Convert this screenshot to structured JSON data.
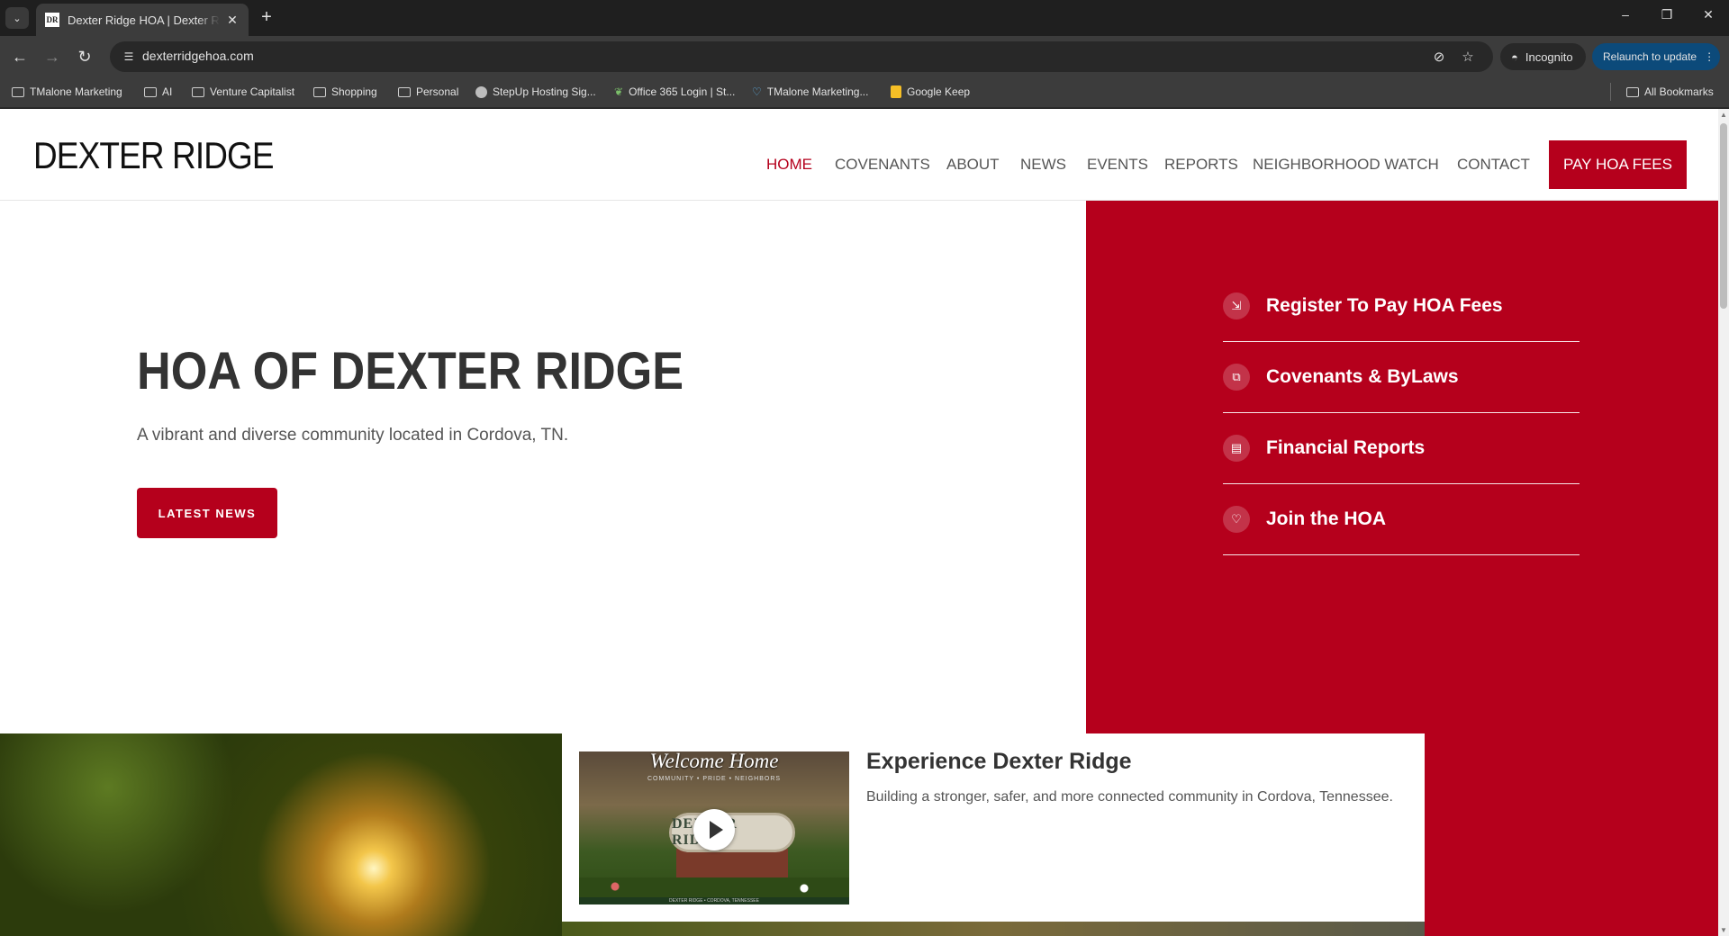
{
  "browser": {
    "tab_title": "Dexter Ridge HOA | Dexter Ridge",
    "tab_favicon": "DR",
    "url": "dexterridgehoa.com",
    "incognito_label": "Incognito",
    "relaunch_label": "Relaunch to update",
    "bookmarks": [
      {
        "label": "TMalone Marketing",
        "icon": "folder-icon"
      },
      {
        "label": "AI",
        "icon": "folder-icon"
      },
      {
        "label": "Venture Capitalist",
        "icon": "folder-icon"
      },
      {
        "label": "Shopping",
        "icon": "folder-icon"
      },
      {
        "label": "Personal",
        "icon": "folder-icon"
      },
      {
        "label": "StepUp Hosting Sig...",
        "icon": "globe-icon"
      },
      {
        "label": "Office 365 Login | St...",
        "icon": "leaf-icon"
      },
      {
        "label": "TMalone Marketing...",
        "icon": "heart-icon"
      },
      {
        "label": "Google Keep",
        "icon": "keep-icon"
      }
    ],
    "all_bookmarks_label": "All Bookmarks"
  },
  "site": {
    "logo": "DEXTER RIDGE",
    "nav": [
      "HOME",
      "COVENANTS",
      "ABOUT",
      "NEWS",
      "EVENTS",
      "REPORTS",
      "NEIGHBORHOOD WATCH",
      "CONTACT"
    ],
    "active_nav": "HOME",
    "pay_button": "PAY HOA FEES",
    "hero": {
      "title": "HOA OF DEXTER RIDGE",
      "subtitle": "A vibrant and diverse community located in Cordova, TN.",
      "button": "LATEST NEWS"
    },
    "quick_links": [
      {
        "label": "Register To Pay HOA Fees",
        "icon": "register-icon"
      },
      {
        "label": "Covenants & ByLaws",
        "icon": "copy-icon"
      },
      {
        "label": "Financial Reports",
        "icon": "document-icon"
      },
      {
        "label": "Join the HOA",
        "icon": "heart-icon"
      }
    ],
    "experience": {
      "title": "Experience Dexter Ridge",
      "text": "Building a stronger, safer, and more connected community in Cordova, Tennessee.",
      "video_script": "Welcome Home",
      "video_tagline": "COMMUNITY • PRIDE • NEIGHBORS",
      "video_sign": "DEXTER RIDGE",
      "video_footer": "DEXTER RIDGE • CORDOVA, TENNESSEE"
    }
  },
  "colors": {
    "brand_red": "#b5001c",
    "text_dark": "#333333",
    "chrome_bg": "#3c3c3c"
  }
}
